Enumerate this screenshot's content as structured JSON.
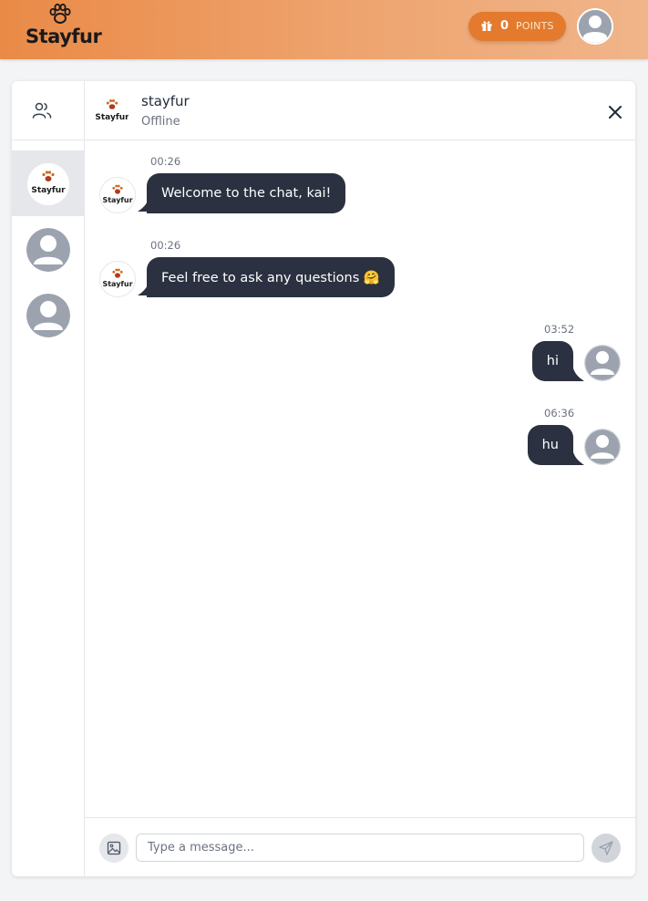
{
  "header": {
    "brand": "Stayfur",
    "points": {
      "count": "0",
      "label": "POINTS"
    }
  },
  "chat": {
    "contact_name": "stayfur",
    "contact_status": "Offline",
    "messages": [
      {
        "time": "00:26",
        "text": "Welcome to the chat, kai!",
        "direction": "in"
      },
      {
        "time": "00:26",
        "text": "Feel free to ask any questions 🤗",
        "direction": "in"
      },
      {
        "time": "03:52",
        "text": "hi",
        "direction": "out"
      },
      {
        "time": "06:36",
        "text": "hu",
        "direction": "out"
      }
    ]
  },
  "composer": {
    "placeholder": "Type a message..."
  },
  "colors": {
    "accent": "#e37a2d",
    "bubble": "#2b3140",
    "header_start": "#ea8a47",
    "header_end": "#f0b58a"
  },
  "icons": [
    "paw-logo-icon",
    "gift-icon",
    "users-icon",
    "close-icon",
    "image-icon",
    "send-icon",
    "avatar-placeholder-icon"
  ]
}
